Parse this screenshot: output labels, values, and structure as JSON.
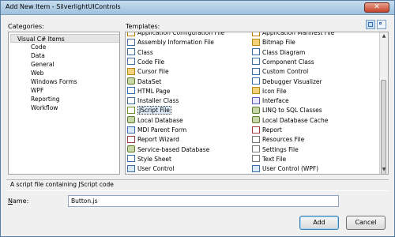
{
  "window": {
    "title": "Add New Item - SilverlightUIControls",
    "close_glyph": "✕"
  },
  "categories": {
    "label": "Categories:",
    "items": [
      "Visual C# Items",
      "Code",
      "Data",
      "General",
      "Web",
      "Windows Forms",
      "WPF",
      "Reporting",
      "Workflow"
    ],
    "selected_index": 0
  },
  "templates": {
    "label": "Templates:",
    "left": [
      {
        "label": "Application Configuration File",
        "icon": "xml"
      },
      {
        "label": "Assembly Information File",
        "icon": "cs"
      },
      {
        "label": "Class",
        "icon": "cs"
      },
      {
        "label": "Code File",
        "icon": "cs"
      },
      {
        "label": "Cursor File",
        "icon": "img"
      },
      {
        "label": "DataSet",
        "icon": "db"
      },
      {
        "label": "HTML Page",
        "icon": "html"
      },
      {
        "label": "Installer Class",
        "icon": "cs"
      },
      {
        "label": "JScript File",
        "icon": "js"
      },
      {
        "label": "Local Database",
        "icon": "db"
      },
      {
        "label": "MDI Parent Form",
        "icon": "form"
      },
      {
        "label": "Report Wizard",
        "icon": "report"
      },
      {
        "label": "Service-based Database",
        "icon": "db"
      },
      {
        "label": "Style Sheet",
        "icon": "html"
      },
      {
        "label": "User Control",
        "icon": "form"
      }
    ],
    "right": [
      {
        "label": "Application Manifest File",
        "icon": "xml"
      },
      {
        "label": "Bitmap File",
        "icon": "img"
      },
      {
        "label": "Class Diagram",
        "icon": "cs"
      },
      {
        "label": "Component Class",
        "icon": "cs"
      },
      {
        "label": "Custom Control",
        "icon": "cs"
      },
      {
        "label": "Debugger Visualizer",
        "icon": "cs"
      },
      {
        "label": "Icon File",
        "icon": "img"
      },
      {
        "label": "Interface",
        "icon": "iface"
      },
      {
        "label": "LINQ to SQL Classes",
        "icon": "db"
      },
      {
        "label": "Local Database Cache",
        "icon": "db"
      },
      {
        "label": "Report",
        "icon": "report"
      },
      {
        "label": "Resources File",
        "icon": "txt"
      },
      {
        "label": "Settings File",
        "icon": "txt"
      },
      {
        "label": "Text File",
        "icon": "txt"
      },
      {
        "label": "User Control (WPF)",
        "icon": "form"
      }
    ],
    "selected": "JScript File"
  },
  "description": "A script file containing JScript code",
  "name_field": {
    "label": "Name:",
    "value": "Button.js"
  },
  "buttons": {
    "add": "Add",
    "cancel": "Cancel"
  },
  "view_icons": [
    "large-icons-view-icon",
    "small-icons-view-icon"
  ]
}
